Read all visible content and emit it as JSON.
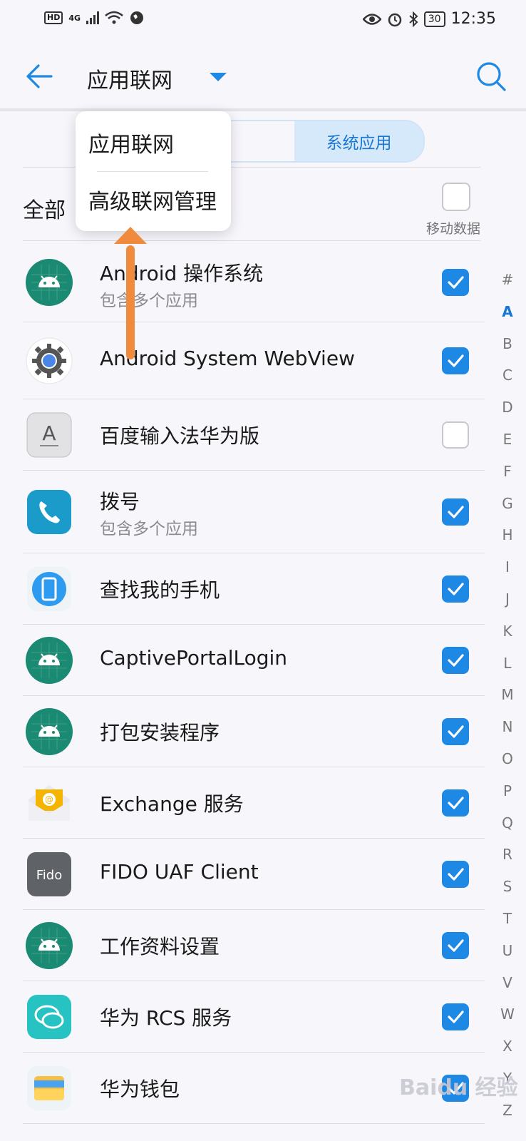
{
  "status_bar": {
    "left_badge": "HD",
    "network": "4G",
    "battery": "30",
    "time": "12:35"
  },
  "app_bar": {
    "title": "应用联网",
    "back_icon": "arrow-left-icon",
    "search_icon": "search-icon"
  },
  "segment": {
    "tab1": "",
    "tab2": "系统应用"
  },
  "dropdown": {
    "items": [
      "应用联网",
      "高级联网管理"
    ]
  },
  "header_row": {
    "label": "全部",
    "column_label": "移动数据",
    "checked": false
  },
  "apps": [
    {
      "name": "Android 操作系统",
      "sub": "包含多个应用",
      "icon": "android-icon",
      "checked": true
    },
    {
      "name": "Android System WebView",
      "sub": "",
      "icon": "settings-gear-icon",
      "checked": true
    },
    {
      "name": "百度输入法华为版",
      "sub": "",
      "icon": "keyboard-a-icon",
      "checked": false
    },
    {
      "name": "拨号",
      "sub": "包含多个应用",
      "icon": "phone-icon",
      "checked": true
    },
    {
      "name": "查找我的手机",
      "sub": "",
      "icon": "find-phone-icon",
      "checked": true
    },
    {
      "name": "CaptivePortalLogin",
      "sub": "",
      "icon": "android-icon",
      "checked": true
    },
    {
      "name": "打包安装程序",
      "sub": "",
      "icon": "android-icon",
      "checked": true
    },
    {
      "name": "Exchange 服务",
      "sub": "",
      "icon": "mail-icon",
      "checked": true
    },
    {
      "name": "FIDO UAF Client",
      "sub": "",
      "icon": "fido-icon",
      "checked": true
    },
    {
      "name": "工作资料设置",
      "sub": "",
      "icon": "android-icon",
      "checked": true
    },
    {
      "name": "华为 RCS 服务",
      "sub": "",
      "icon": "chat-icon",
      "checked": true
    },
    {
      "name": "华为钱包",
      "sub": "",
      "icon": "wallet-icon",
      "checked": true
    }
  ],
  "fido_icon_text": "Fido",
  "alphabet": [
    "#",
    "A",
    "B",
    "C",
    "D",
    "E",
    "F",
    "G",
    "H",
    "I",
    "J",
    "K",
    "L",
    "M",
    "N",
    "O",
    "P",
    "Q",
    "R",
    "S",
    "T",
    "U",
    "V",
    "W",
    "X",
    "Y",
    "Z"
  ],
  "alphabet_current": "A",
  "colors": {
    "accent": "#1e88e5",
    "android_green": "#1a8a72",
    "annotation_arrow": "#f08a3c"
  },
  "watermark": "Baidu 经验"
}
